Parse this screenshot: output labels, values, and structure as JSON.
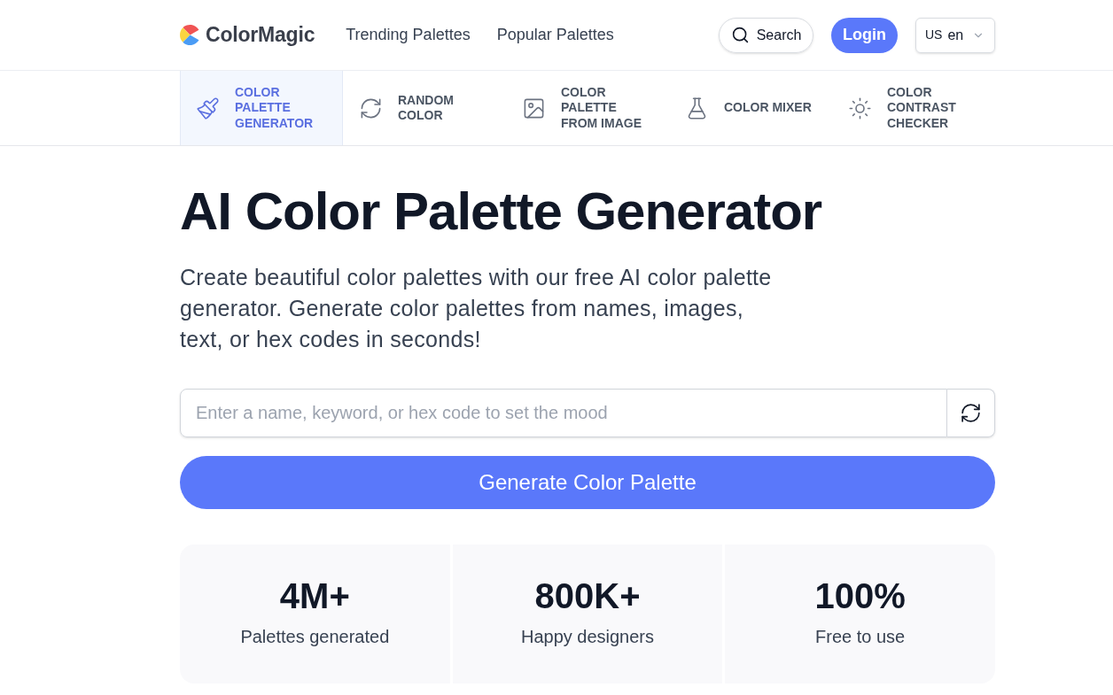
{
  "header": {
    "logo": "ColorMagic",
    "nav": [
      {
        "label": "Trending Palettes"
      },
      {
        "label": "Popular Palettes"
      }
    ],
    "search_button": "Search",
    "login_button": "Login",
    "language": {
      "region": "US",
      "code": "en"
    }
  },
  "tools": [
    {
      "label": "COLOR PALETTE GENERATOR",
      "selected": true
    },
    {
      "label": "RANDOM COLOR",
      "selected": false
    },
    {
      "label": "COLOR PALETTE FROM IMAGE",
      "selected": false
    },
    {
      "label": "COLOR MIXER",
      "selected": false
    },
    {
      "label": "COLOR CONTRAST CHECKER",
      "selected": false
    }
  ],
  "hero": {
    "title": "AI Color Palette Generator",
    "subtitle": "Create beautiful color palettes with our free AI color palette generator. Generate color palettes from names, images, text, or hex codes in seconds!"
  },
  "mood_input": {
    "placeholder": "Enter a name, keyword, or hex code to set the mood"
  },
  "generate_button": "Generate Color Palette",
  "stats": [
    {
      "value": "4M+",
      "label": "Palettes generated"
    },
    {
      "value": "800K+",
      "label": "Happy designers"
    },
    {
      "value": "100%",
      "label": "Free to use"
    }
  ]
}
